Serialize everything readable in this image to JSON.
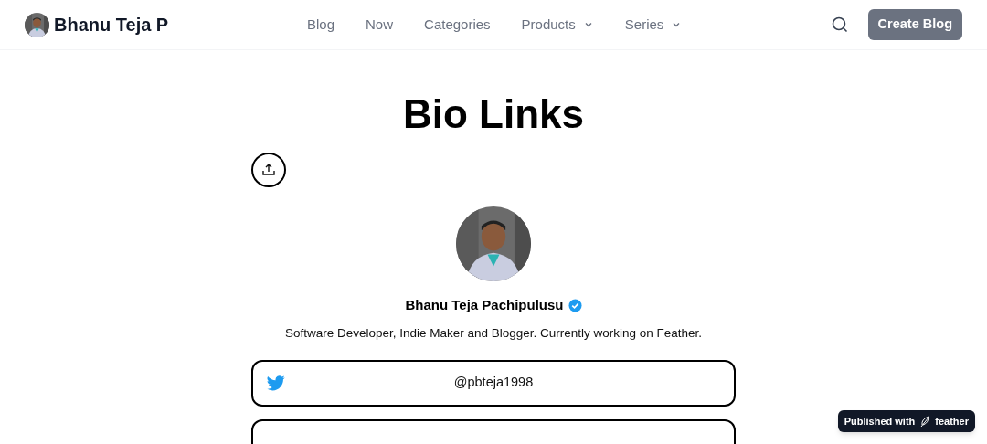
{
  "header": {
    "site_name": "Bhanu Teja P",
    "nav": [
      {
        "label": "Blog",
        "has_menu": false
      },
      {
        "label": "Now",
        "has_menu": false
      },
      {
        "label": "Categories",
        "has_menu": false
      },
      {
        "label": "Products",
        "has_menu": true
      },
      {
        "label": "Series",
        "has_menu": true
      }
    ],
    "button": "Create Blog"
  },
  "page": {
    "title": "Bio Links",
    "profile": {
      "name": "Bhanu Teja Pachipulusu",
      "verified": true,
      "bio": "Software Developer, Indie Maker and Blogger. Currently working on Feather."
    },
    "links": [
      {
        "kind": "twitter",
        "label": "@pbteja1998"
      }
    ]
  },
  "badge": {
    "prefix": "Published with",
    "brand": "feather"
  }
}
